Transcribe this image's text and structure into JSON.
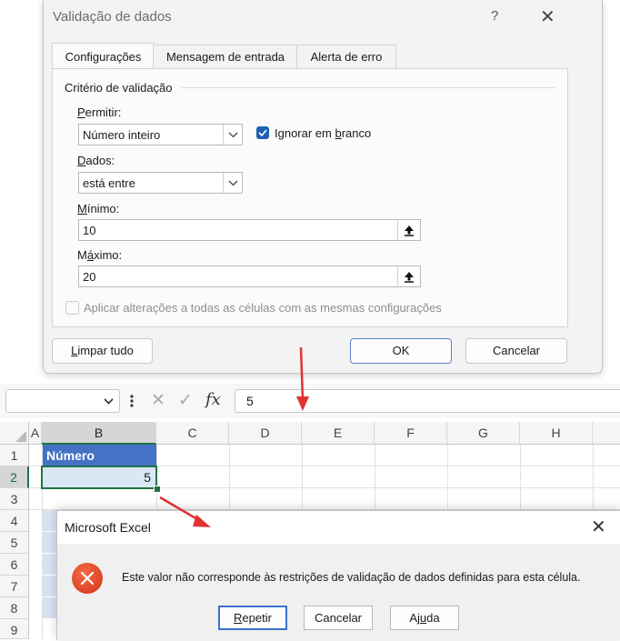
{
  "validation_dialog": {
    "title": "Validação de dados",
    "help_symbol": "?",
    "close_symbol": "✕",
    "tabs": [
      {
        "label": "Configurações",
        "active": true
      },
      {
        "label": "Mensagem de entrada",
        "active": false
      },
      {
        "label": "Alerta de erro",
        "active": false
      }
    ],
    "group_label": "Critério de validação",
    "allow": {
      "label_pre": "",
      "label_u": "P",
      "label_post": "ermitir:",
      "value": "Número inteiro"
    },
    "ignore_blank": {
      "label_pre": "Ignorar em ",
      "label_u": "b",
      "label_post": "ranco",
      "checked": true
    },
    "data": {
      "label_pre": "",
      "label_u": "D",
      "label_post": "ados:",
      "value": "está entre"
    },
    "minimum": {
      "label_pre": "",
      "label_u": "M",
      "label_post": "ínimo:",
      "value": "10"
    },
    "maximum": {
      "label_pre": "M",
      "label_u": "á",
      "label_post": "ximo:",
      "value": "20"
    },
    "apply_all": {
      "label": "Aplicar alterações a todas as células com as mesmas configurações",
      "checked": false,
      "disabled": true
    },
    "buttons": {
      "clear_pre": "",
      "clear_u": "L",
      "clear_post": "impar tudo",
      "ok": "OK",
      "cancel": "Cancelar"
    }
  },
  "formula_bar": {
    "name_box_value": "",
    "cancel_symbol": "✕",
    "enter_symbol": "✓",
    "fx_symbol": "fx",
    "formula_value": "5"
  },
  "sheet": {
    "columns": [
      "A",
      "B",
      "C",
      "D",
      "E",
      "F",
      "G",
      "H"
    ],
    "rows": [
      "1",
      "2",
      "3",
      "4",
      "5",
      "6",
      "7",
      "8",
      "9"
    ],
    "header_cell": "Número",
    "value_cell": "5",
    "accent_header": "#4472c4",
    "accent_selection": "#217346"
  },
  "error_dialog": {
    "title": "Microsoft Excel",
    "close_symbol": "✕",
    "message": "Este valor não corresponde às restrições de validação de dados definidas para esta célula.",
    "icon": "error-icon",
    "icon_color": "#e0431f",
    "buttons": {
      "retry_pre": "",
      "retry_u": "R",
      "retry_post": "epetir",
      "cancel": "Cancelar",
      "help_pre": "Aj",
      "help_u": "u",
      "help_post": "da"
    }
  }
}
